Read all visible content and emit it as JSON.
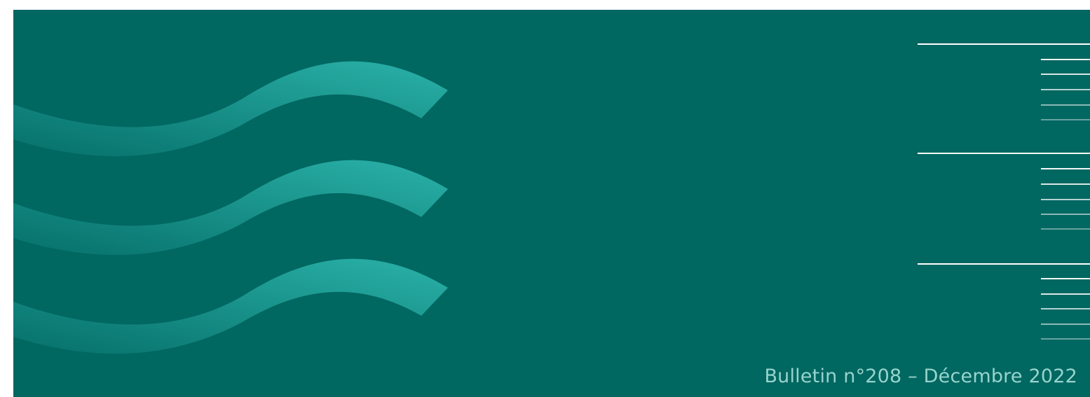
{
  "banner": {
    "background_color": "#016761",
    "wave_color": "#2cb5ac",
    "rule_color": "#ffffff",
    "caption": "Bulletin n°208 – Décembre 2022",
    "caption_color": "#97d4cd"
  }
}
